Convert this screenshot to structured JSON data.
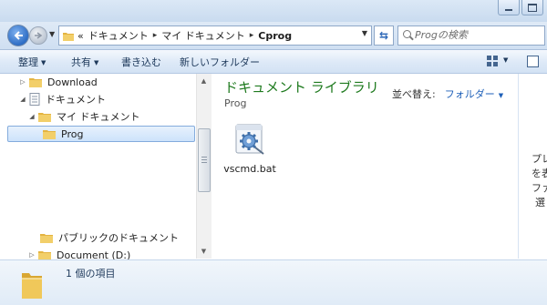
{
  "address": {
    "overflow_glyph": "«",
    "crumbs": [
      "ドキュメント",
      "マイ ドキュメント",
      "Cprog"
    ],
    "separator": "▸"
  },
  "search": {
    "placeholder": "Progの検索"
  },
  "toolbar": {
    "organize_label": "整理",
    "share_label": "共有",
    "burn_label": "書き込む",
    "new_folder_label": "新しいフォルダー",
    "dropdown_glyph": "▼"
  },
  "nav": {
    "items": [
      {
        "label": "Download",
        "expander": "▷",
        "icon": "folder-icon"
      },
      {
        "label": "ドキュメント",
        "expander": "◢",
        "icon": "documents-library-icon"
      },
      {
        "label": "マイ ドキュメント",
        "expander": "◢",
        "icon": "folder-icon"
      },
      {
        "label": "Prog",
        "expander": "",
        "icon": "folder-icon",
        "selected": true
      },
      {
        "label": "パブリックのドキュメント",
        "expander": "",
        "icon": "folder-icon"
      },
      {
        "label": "Document (D:)",
        "expander": "▷",
        "icon": "folder-icon"
      }
    ]
  },
  "library": {
    "title": "ドキュメント ライブラリ",
    "subtitle": "Prog",
    "arrange_label": "並べ替え:",
    "arrange_value": "フォルダー"
  },
  "files": [
    {
      "name": "vscmd.bat",
      "icon": "batch-file-gear-icon"
    }
  ],
  "preview_text": [
    "プレ",
    "を表",
    "ファ",
    "選"
  ],
  "details": {
    "count_text": "1 個の項目"
  },
  "colors": {
    "library_title": "#1e7a1e",
    "link_blue": "#1d5fb8",
    "selection": "#cde3fb"
  }
}
